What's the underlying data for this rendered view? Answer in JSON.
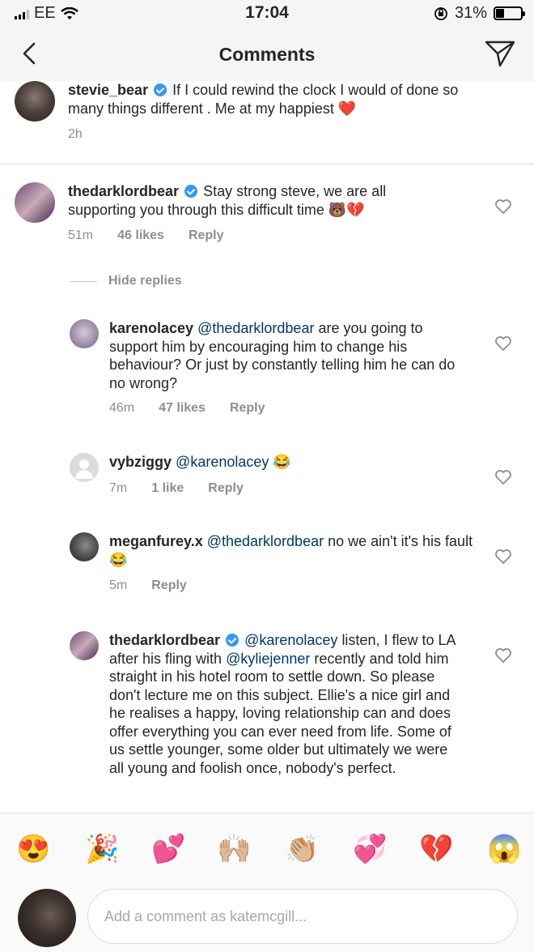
{
  "status_bar": {
    "carrier": "EE",
    "time": "17:04",
    "battery": "31%",
    "battery_level": 0.31
  },
  "header": {
    "title": "Comments"
  },
  "caption": {
    "username": "stevie_bear",
    "text": "If I could rewind the clock I would of done so many things different . Me at my happiest ❤️",
    "time": "2h"
  },
  "comments": [
    {
      "username": "thedarklordbear",
      "verified": true,
      "text": "Stay strong steve, we are all supporting you through this difficult time 🐻💔",
      "time": "51m",
      "likes": "46 likes",
      "reply": "Reply"
    },
    {
      "username": "karenolacey",
      "mention": "@thedarklordbear",
      "text": "are you going to support him by encouraging him to change his behaviour? Or just by constantly telling him he can do no wrong?",
      "time": "46m",
      "likes": "47 likes",
      "reply": "Reply"
    },
    {
      "username": "vybziggy",
      "mention": "@karenolacey",
      "text": "😂",
      "time": "7m",
      "likes": "1 like",
      "reply": "Reply"
    },
    {
      "username": "meganfurey.x",
      "mention": "@thedarklordbear",
      "text": "no we ain't it's his fault 😂",
      "time": "5m",
      "reply": "Reply"
    },
    {
      "username": "thedarklordbear",
      "verified": true,
      "mention": "@karenolacey",
      "text_a": "listen, I flew to LA after his fling with",
      "mention2": "@kyliejenner",
      "text_b": "recently and told him straight in his hotel room to settle down. So please don't lecture me on this subject. Ellie's a nice girl and he realises a happy, loving relationship can and does offer everything you can ever need from life. Some of us settle younger, some older but ultimately we were all young and foolish once, nobody's perfect."
    }
  ],
  "hide_replies": "Hide replies",
  "emojis": [
    "😍",
    "🎉",
    "💕",
    "🙌🏼",
    "👏🏼",
    "💞",
    "💔",
    "😱"
  ],
  "comment_input": {
    "placeholder": "Add a comment as katemcgill..."
  }
}
